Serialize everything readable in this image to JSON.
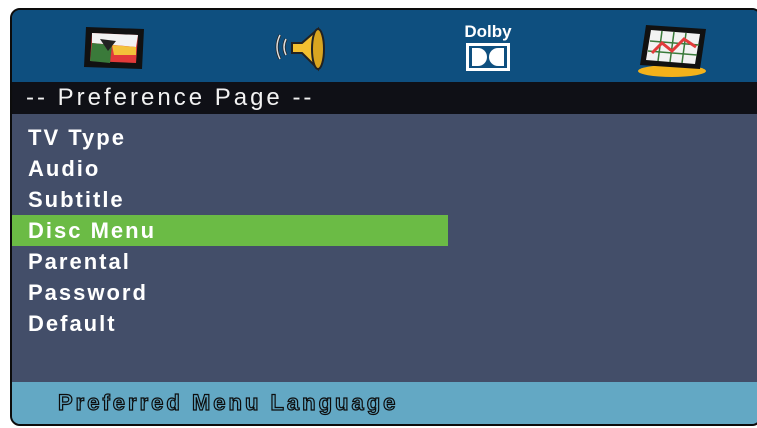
{
  "header": {
    "tabs": [
      {
        "icon": "tv-screen-icon"
      },
      {
        "icon": "speaker-icon"
      },
      {
        "icon": "dolby-icon",
        "label": "Dolby"
      },
      {
        "icon": "preference-chart-icon"
      }
    ]
  },
  "page": {
    "title": "-- Preference Page --"
  },
  "menu": {
    "items": [
      {
        "label": "TV Type"
      },
      {
        "label": "Audio"
      },
      {
        "label": "Subtitle"
      },
      {
        "label": "Disc Menu",
        "selected": true
      },
      {
        "label": "Parental"
      },
      {
        "label": "Password"
      },
      {
        "label": "Default"
      }
    ]
  },
  "status": {
    "text": "Preferred Menu Language"
  },
  "colors": {
    "selection": "#6bbb45",
    "header": "#0e4f7f",
    "background": "#434e69",
    "status_bar": "#63a8c4"
  }
}
